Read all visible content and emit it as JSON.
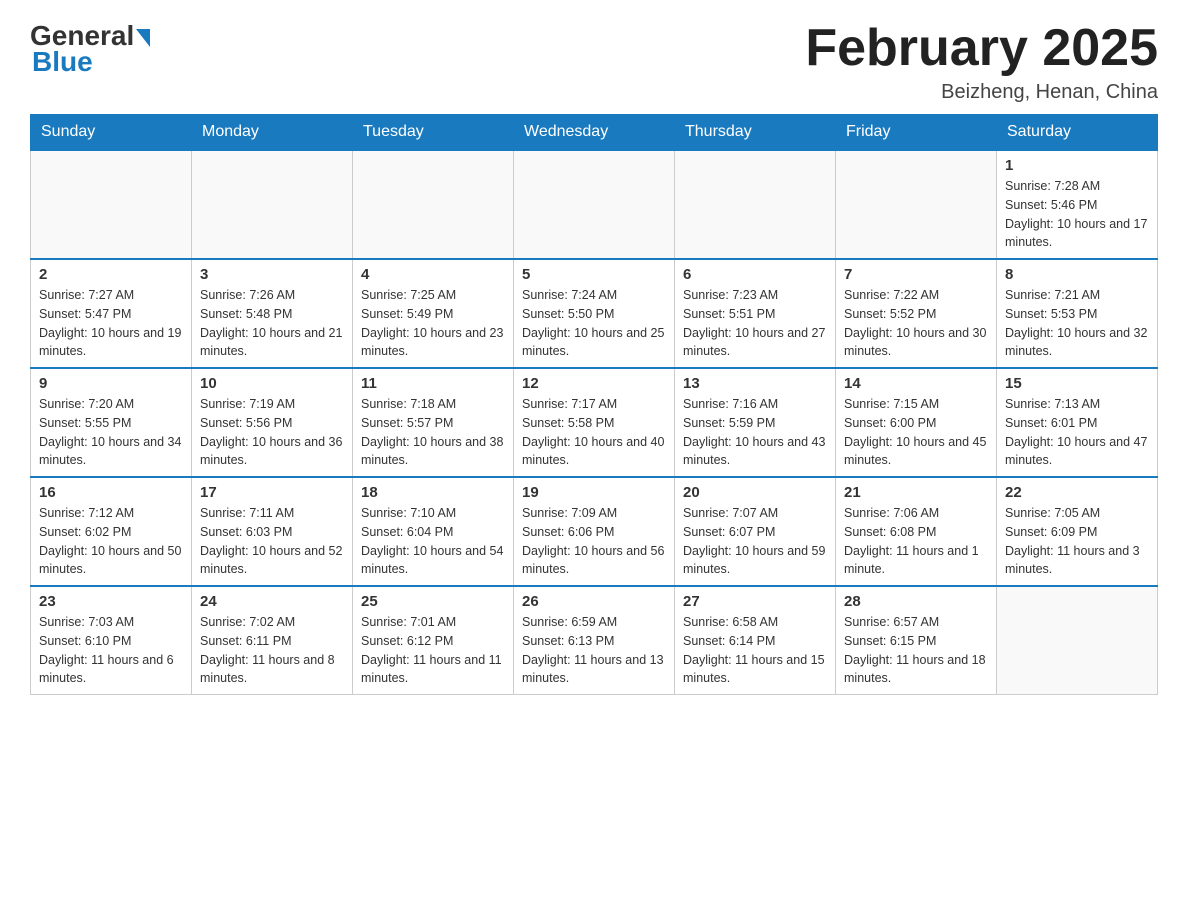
{
  "header": {
    "logo_general": "General",
    "logo_blue": "Blue",
    "month_title": "February 2025",
    "subtitle": "Beizheng, Henan, China"
  },
  "weekdays": [
    "Sunday",
    "Monday",
    "Tuesday",
    "Wednesday",
    "Thursday",
    "Friday",
    "Saturday"
  ],
  "weeks": [
    [
      {
        "day": "",
        "info": ""
      },
      {
        "day": "",
        "info": ""
      },
      {
        "day": "",
        "info": ""
      },
      {
        "day": "",
        "info": ""
      },
      {
        "day": "",
        "info": ""
      },
      {
        "day": "",
        "info": ""
      },
      {
        "day": "1",
        "info": "Sunrise: 7:28 AM\nSunset: 5:46 PM\nDaylight: 10 hours and 17 minutes."
      }
    ],
    [
      {
        "day": "2",
        "info": "Sunrise: 7:27 AM\nSunset: 5:47 PM\nDaylight: 10 hours and 19 minutes."
      },
      {
        "day": "3",
        "info": "Sunrise: 7:26 AM\nSunset: 5:48 PM\nDaylight: 10 hours and 21 minutes."
      },
      {
        "day": "4",
        "info": "Sunrise: 7:25 AM\nSunset: 5:49 PM\nDaylight: 10 hours and 23 minutes."
      },
      {
        "day": "5",
        "info": "Sunrise: 7:24 AM\nSunset: 5:50 PM\nDaylight: 10 hours and 25 minutes."
      },
      {
        "day": "6",
        "info": "Sunrise: 7:23 AM\nSunset: 5:51 PM\nDaylight: 10 hours and 27 minutes."
      },
      {
        "day": "7",
        "info": "Sunrise: 7:22 AM\nSunset: 5:52 PM\nDaylight: 10 hours and 30 minutes."
      },
      {
        "day": "8",
        "info": "Sunrise: 7:21 AM\nSunset: 5:53 PM\nDaylight: 10 hours and 32 minutes."
      }
    ],
    [
      {
        "day": "9",
        "info": "Sunrise: 7:20 AM\nSunset: 5:55 PM\nDaylight: 10 hours and 34 minutes."
      },
      {
        "day": "10",
        "info": "Sunrise: 7:19 AM\nSunset: 5:56 PM\nDaylight: 10 hours and 36 minutes."
      },
      {
        "day": "11",
        "info": "Sunrise: 7:18 AM\nSunset: 5:57 PM\nDaylight: 10 hours and 38 minutes."
      },
      {
        "day": "12",
        "info": "Sunrise: 7:17 AM\nSunset: 5:58 PM\nDaylight: 10 hours and 40 minutes."
      },
      {
        "day": "13",
        "info": "Sunrise: 7:16 AM\nSunset: 5:59 PM\nDaylight: 10 hours and 43 minutes."
      },
      {
        "day": "14",
        "info": "Sunrise: 7:15 AM\nSunset: 6:00 PM\nDaylight: 10 hours and 45 minutes."
      },
      {
        "day": "15",
        "info": "Sunrise: 7:13 AM\nSunset: 6:01 PM\nDaylight: 10 hours and 47 minutes."
      }
    ],
    [
      {
        "day": "16",
        "info": "Sunrise: 7:12 AM\nSunset: 6:02 PM\nDaylight: 10 hours and 50 minutes."
      },
      {
        "day": "17",
        "info": "Sunrise: 7:11 AM\nSunset: 6:03 PM\nDaylight: 10 hours and 52 minutes."
      },
      {
        "day": "18",
        "info": "Sunrise: 7:10 AM\nSunset: 6:04 PM\nDaylight: 10 hours and 54 minutes."
      },
      {
        "day": "19",
        "info": "Sunrise: 7:09 AM\nSunset: 6:06 PM\nDaylight: 10 hours and 56 minutes."
      },
      {
        "day": "20",
        "info": "Sunrise: 7:07 AM\nSunset: 6:07 PM\nDaylight: 10 hours and 59 minutes."
      },
      {
        "day": "21",
        "info": "Sunrise: 7:06 AM\nSunset: 6:08 PM\nDaylight: 11 hours and 1 minute."
      },
      {
        "day": "22",
        "info": "Sunrise: 7:05 AM\nSunset: 6:09 PM\nDaylight: 11 hours and 3 minutes."
      }
    ],
    [
      {
        "day": "23",
        "info": "Sunrise: 7:03 AM\nSunset: 6:10 PM\nDaylight: 11 hours and 6 minutes."
      },
      {
        "day": "24",
        "info": "Sunrise: 7:02 AM\nSunset: 6:11 PM\nDaylight: 11 hours and 8 minutes."
      },
      {
        "day": "25",
        "info": "Sunrise: 7:01 AM\nSunset: 6:12 PM\nDaylight: 11 hours and 11 minutes."
      },
      {
        "day": "26",
        "info": "Sunrise: 6:59 AM\nSunset: 6:13 PM\nDaylight: 11 hours and 13 minutes."
      },
      {
        "day": "27",
        "info": "Sunrise: 6:58 AM\nSunset: 6:14 PM\nDaylight: 11 hours and 15 minutes."
      },
      {
        "day": "28",
        "info": "Sunrise: 6:57 AM\nSunset: 6:15 PM\nDaylight: 11 hours and 18 minutes."
      },
      {
        "day": "",
        "info": ""
      }
    ]
  ]
}
